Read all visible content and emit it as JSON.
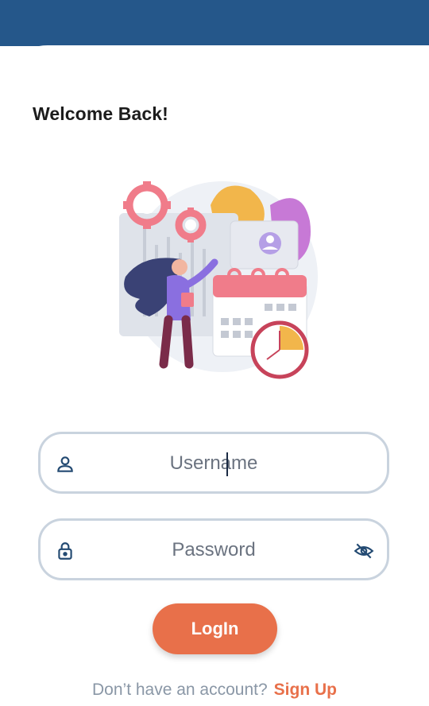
{
  "header": {
    "color": "#25578a"
  },
  "welcome": {
    "title": "Welcome Back!"
  },
  "form": {
    "username": {
      "placeholder": "Username",
      "icon": "person-icon"
    },
    "password": {
      "placeholder": "Password",
      "icon": "lock-icon",
      "toggle_icon": "eye-off-icon"
    },
    "login_label": "LogIn"
  },
  "signup": {
    "prompt": "Don’t have an account?",
    "link": "Sign Up"
  },
  "colors": {
    "accent": "#e8704a",
    "field_border": "#c9d3de",
    "icon": "#234a72"
  }
}
